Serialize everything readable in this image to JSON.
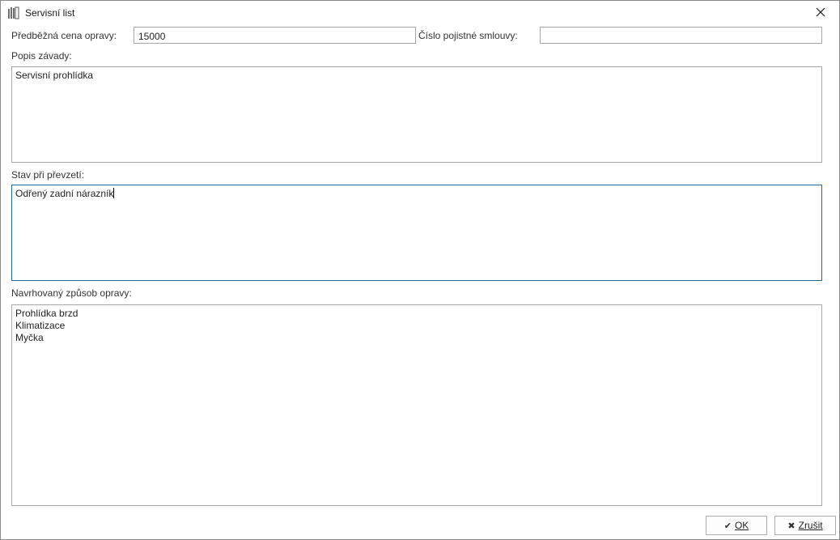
{
  "window": {
    "title": "Servisní list",
    "icon": "document-bars-icon",
    "close_icon": "close-icon"
  },
  "form": {
    "price_label": "Předběžná cena opravy:",
    "price_value": "15000",
    "policy_label": "Číslo pojistné smlouvy:",
    "policy_value": "",
    "fault_label": "Popis závady:",
    "fault_value": "Servisní prohlídka",
    "state_label": "Stav při převzetí:",
    "state_value": "Odřený zadní nárazník",
    "repair_label": "Navrhovaný způsob opravy:",
    "repair_value": "Prohlídka brzd\nKlimatizace\nMyčka"
  },
  "buttons": {
    "ok_glyph": "✔",
    "ok_label": "OK",
    "cancel_glyph": "✖",
    "cancel_label": "Zrušit"
  },
  "colors": {
    "focus_border": "#1e6c9e",
    "input_border": "#a7a7a7"
  }
}
